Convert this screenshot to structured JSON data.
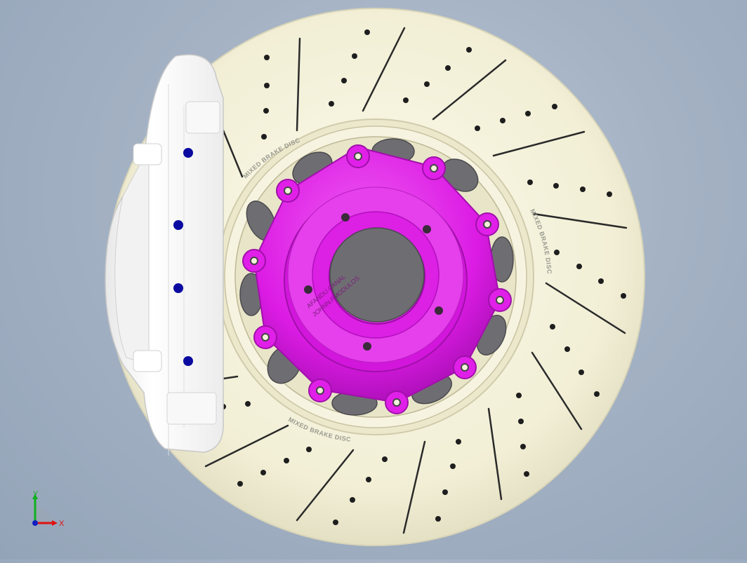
{
  "scene": {
    "disc_label": "MIXED BRAKE DISC",
    "hub_label_line1": "AFANDU.CANAL",
    "hub_label_line2": "JOHNN.FMODULOS"
  },
  "triad": {
    "x_label": "X",
    "y_label": "Y",
    "x_color": "#e01010",
    "y_color": "#10b020",
    "z_color": "#1020c0"
  },
  "colors": {
    "disc": "#f4f1dc",
    "hub": "#e020e8",
    "caliper": "#fafafa",
    "caliper_pistons": "#0a0aa0",
    "vent": "#6e6e72"
  }
}
